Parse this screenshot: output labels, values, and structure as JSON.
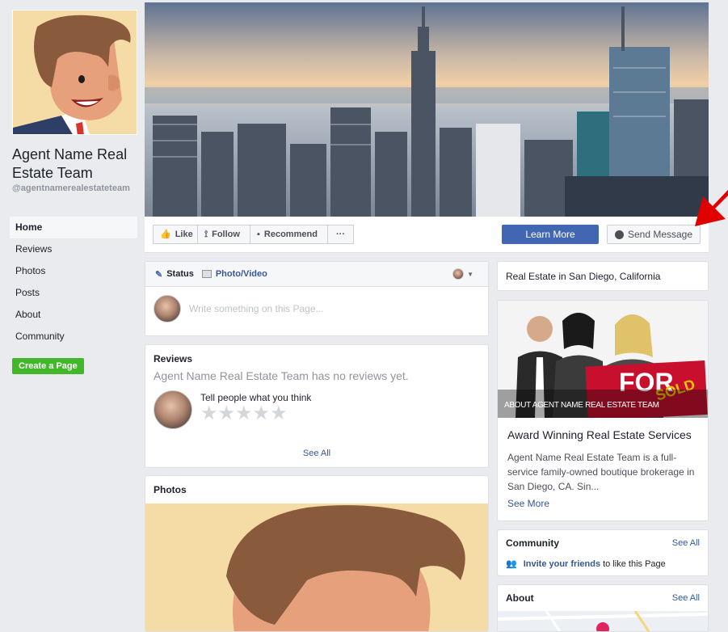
{
  "profile": {
    "name": "Agent Name Real Estate Team",
    "handle": "@agentnamerealestateteam"
  },
  "nav": {
    "items": [
      {
        "label": "Home",
        "active": true
      },
      {
        "label": "Reviews"
      },
      {
        "label": "Photos"
      },
      {
        "label": "Posts"
      },
      {
        "label": "About"
      },
      {
        "label": "Community"
      }
    ],
    "create_page": "Create a Page"
  },
  "actions": {
    "like": "Like",
    "follow": "Follow",
    "recommend": "Recommend",
    "more": "···",
    "learn_more": "Learn More",
    "send_message": "Send Message"
  },
  "composer": {
    "status_tab": "Status",
    "photo_tab": "Photo/Video",
    "placeholder": "Write something on this Page..."
  },
  "reviews": {
    "title": "Reviews",
    "empty": "Agent Name Real Estate Team has no reviews yet.",
    "prompt": "Tell people what you think",
    "stars": "★★★★★",
    "see_all": "See All"
  },
  "photos": {
    "title": "Photos"
  },
  "sidebar": {
    "category": "Real Estate in San Diego, California",
    "about_caption": "ABOUT AGENT NAME REAL ESTATE TEAM",
    "sign_text": "FOR",
    "sign_sold": "SOLD",
    "about_title": "Award Winning Real Estate Services",
    "about_desc": "Agent Name Real Estate Team is a full-service family-owned boutique brokerage in San Diego, CA. Sin...",
    "see_more": "See More",
    "community_title": "Community",
    "community_see_all": "See All",
    "invite_link": "Invite your friends",
    "invite_rest": "to like this Page",
    "about_title2": "About",
    "about_see_all": "See All"
  },
  "colors": {
    "brand_blue": "#4267b2",
    "link": "#365899",
    "green": "#42b72a",
    "arrow": "#e00000"
  }
}
